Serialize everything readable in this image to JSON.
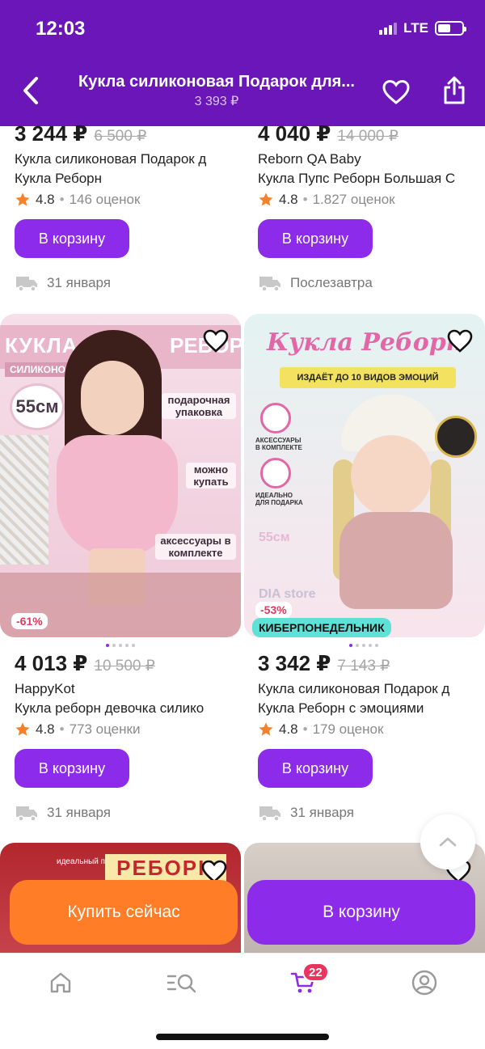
{
  "status": {
    "time": "12:03",
    "network": "LTE"
  },
  "header": {
    "title": "Кукла силиконовая Подарок для...",
    "price": "3 393 ₽"
  },
  "products": [
    {
      "price": "3 244 ₽",
      "old_price": "6 500 ₽",
      "brand": "Кукла силиконовая Подарок д",
      "name": "Кукла Реборн",
      "rating": "4.8",
      "reviews": "146 оценок",
      "cart_label": "В корзину",
      "delivery": "31 января"
    },
    {
      "price": "4 040 ₽",
      "old_price": "14 000 ₽",
      "brand": "Reborn QA Baby",
      "name": "Кукла Пупс Реборн Большая С",
      "rating": "4.8",
      "reviews": "1.827 оценок",
      "cart_label": "В корзину",
      "delivery": "Послезавтра"
    },
    {
      "price": "4 013 ₽",
      "old_price": "10 500 ₽",
      "brand": "HappyKot",
      "name": "Кукла реборн девочка силико",
      "rating": "4.8",
      "reviews": "773 оценки",
      "cart_label": "В корзину",
      "delivery": "31 января",
      "discount": "-61%"
    },
    {
      "price": "3 342 ₽",
      "old_price": "7 143 ₽",
      "brand": "Кукла силиконовая Подарок д",
      "name": "Кукла Реборн с эмоциями",
      "rating": "4.8",
      "reviews": "179 оценок",
      "cart_label": "В корзину",
      "delivery": "31 января",
      "discount": "-53%",
      "promo": "КИБЕРПОНЕДЕЛЬНИК"
    }
  ],
  "card_art": {
    "card1": {
      "word1": "КУКЛА",
      "word2": "РЕБОРН",
      "word3": "СИЛИКОНОВАЯ",
      "size": "55см",
      "f1": "подарочная упаковка",
      "f2": "можно купать",
      "f3": "аксессуары в комплекте"
    },
    "card2": {
      "title": "Кукла Реборн",
      "ribbon": "ИЗДАЁТ ДО 10 ВИДОВ ЭМОЦИЙ",
      "side1": "АКСЕССУАРЫ В КОМПЛЕКТЕ",
      "side2": "ИДЕАЛЬНО ДЛЯ ПОДАРКА",
      "size": "55см",
      "watermark": "DIA store"
    },
    "card3": {
      "plate": "РЕБОРН",
      "small": "идеальный подарок"
    }
  },
  "actions": {
    "buy_now": "Купить сейчас",
    "to_cart": "В корзину"
  },
  "tabbar": {
    "cart_badge": "22"
  },
  "colors": {
    "brand": "#6a16b8",
    "accent": "#8c2bea",
    "buy": "#ff7d26",
    "badge": "#e8355f"
  }
}
